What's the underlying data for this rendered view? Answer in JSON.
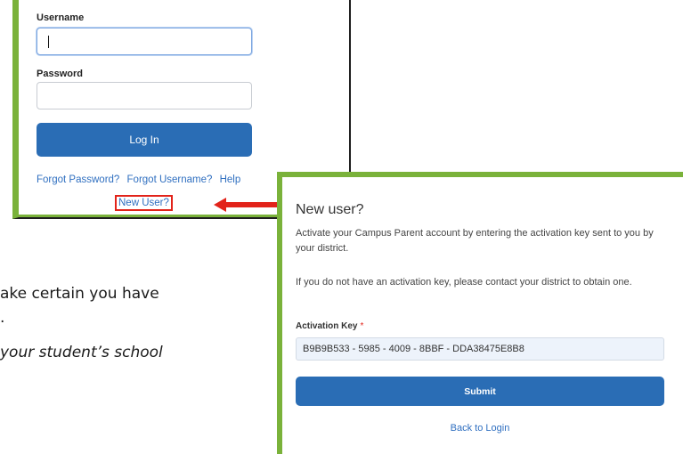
{
  "document": {
    "line1": "ake certain you have",
    "line2": ".",
    "line3": "your student’s school"
  },
  "login": {
    "username_label": "Username",
    "username_value": "",
    "password_label": "Password",
    "password_value": "",
    "login_button": "Log In",
    "links": {
      "forgot_password": "Forgot Password?",
      "forgot_username": "Forgot Username?",
      "help": "Help"
    },
    "new_user_link": "New User?"
  },
  "new_user": {
    "title": "New user?",
    "paragraph1": "Activate your Campus Parent account by entering the activation key sent to you by your district.",
    "paragraph2": "If you do not have an activation key, please contact your district to obtain one.",
    "activation_key_label": "Activation Key",
    "required_marker": "*",
    "activation_key_value": "B9B9B533 - 5985 - 4009 - 8BBF - DDA38475E8B8",
    "submit_button": "Submit",
    "back_link": "Back to Login"
  },
  "colors": {
    "accent_green": "#7ab23a",
    "primary_blue": "#2a6db5",
    "link_blue": "#2f6fc0",
    "highlight_red": "#e2231a"
  },
  "icons": {
    "callout_arrow": "arrow-left-icon"
  }
}
